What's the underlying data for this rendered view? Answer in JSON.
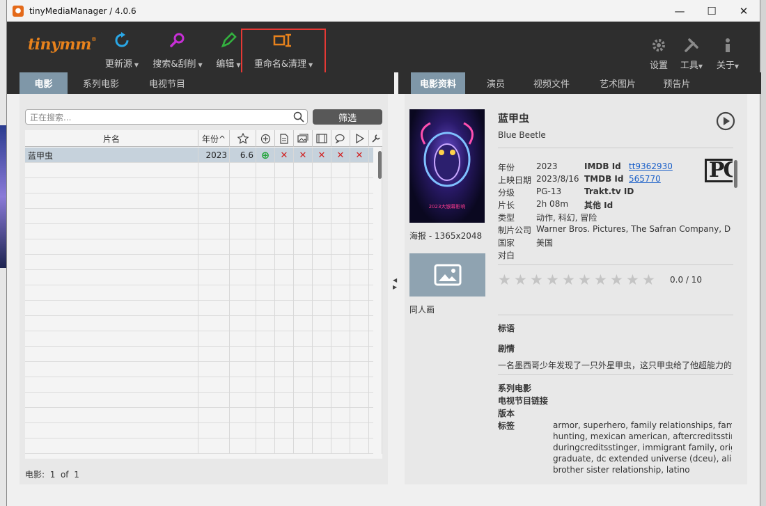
{
  "window": {
    "title": "tinyMediaManager / 4.0.6",
    "app_icon_glyph": "●",
    "minimize_glyph": "—",
    "maximize_glyph": "☐",
    "close_glyph": "✕"
  },
  "toolbar": {
    "logo": "tinymm",
    "logo_mark": "®",
    "update": "更新源",
    "search_scrape": "搜索&刮削",
    "edit": "编辑",
    "rename_clean": "重命名&清理",
    "settings": "设置",
    "tools": "工具",
    "about": "关于",
    "caret": "▼"
  },
  "left_tabs": [
    "电影",
    "系列电影",
    "电视节目"
  ],
  "right_tabs": [
    "电影资料",
    "演员",
    "视频文件",
    "艺术图片",
    "预告片"
  ],
  "search": {
    "placeholder": "正在搜索..."
  },
  "filter_button": "筛选",
  "table": {
    "columns": {
      "title": "片名",
      "year": "年份^"
    },
    "rows": [
      {
        "title": "蓝甲虫",
        "year": "2023",
        "rating": "6.6"
      }
    ],
    "mark": "✕",
    "present_mark": "⊕"
  },
  "footer": {
    "label": "电影:",
    "current": "1",
    "of": "of",
    "total": "1"
  },
  "movie": {
    "title": "蓝甲虫",
    "original_title": "Blue Beetle",
    "poster_tagline": "2023大银幕影响",
    "poster_caption": "海报 - 1365x2048",
    "fanart_caption": "同人画",
    "year_label": "年份",
    "year": "2023",
    "release_label": "上映日期",
    "release": "2023/8/16",
    "cert_label": "分级",
    "cert": "PG-13",
    "runtime_label": "片长",
    "runtime": "2h 08m",
    "genre_label": "类型",
    "genre": "动作, 科幻, 冒险",
    "studio_label": "制片公司",
    "studio": "Warner Bros. Pictures, The Safran Company, DC Fi",
    "country_label": "国家",
    "country": "美国",
    "spoken_label": "对白",
    "imdb_label": "IMDB Id",
    "imdb": "tt9362930",
    "tmdb_label": "TMDB Id",
    "tmdb": "565770",
    "trakt_label": "Trakt.tv ID",
    "other_label": "其他 Id",
    "rating_badge": "PG",
    "rating": "0.0 / 10",
    "rating_value": 0.0,
    "stars_total": 10,
    "tagline_label": "标语",
    "plot_label": "剧情",
    "plot": "一名墨西哥少年发现了一只外星甲虫，这只甲虫给了他超能力的",
    "movieset_label": "系列电影",
    "tvshow_link_label": "电视节目链接",
    "edition_label": "版本",
    "tags_label": "标签",
    "tags": [
      "armor, superhero, family relationships, family, i",
      "hunting, mexican american, aftercreditsstinger",
      "duringcreditsstinger, immigrant family, origin, c",
      "graduate, dc extended universe (dceu), alien te",
      "brother sister relationship, latino"
    ]
  },
  "colors": {
    "accent": "#e8821c",
    "tab_active": "#7f97a8",
    "toolbar_bg": "#2e2e2e",
    "highlight": "#e53935",
    "link": "#1a5fc8"
  }
}
